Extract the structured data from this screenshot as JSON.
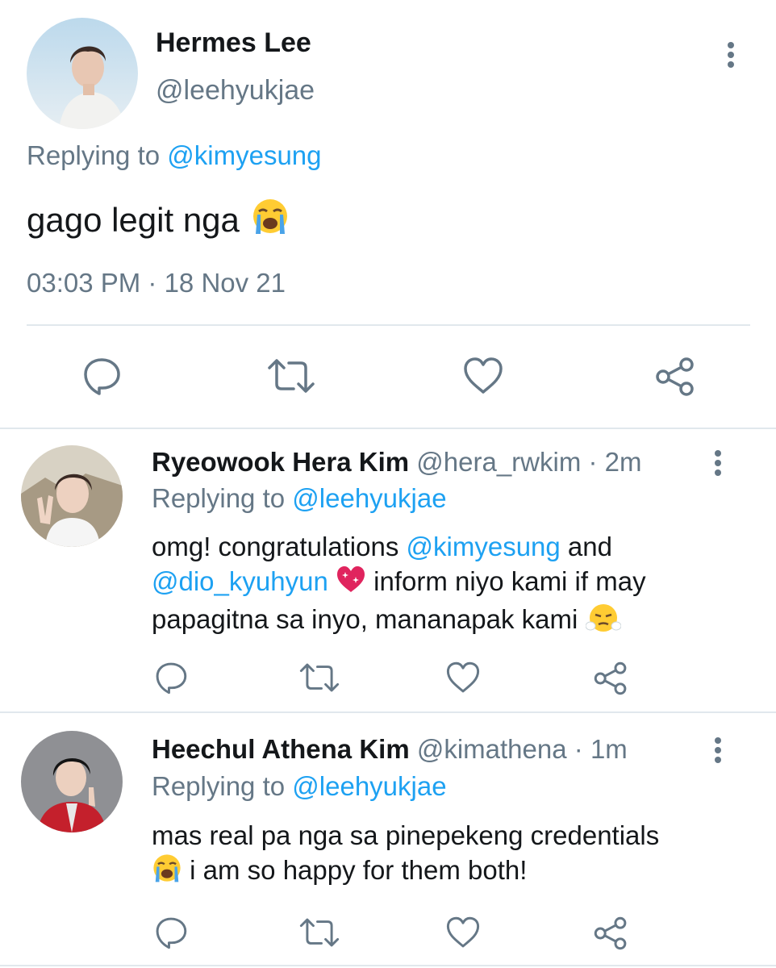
{
  "main_tweet": {
    "author_name": "Hermes Lee",
    "author_handle": "@leehyukjae",
    "replying_prefix": "Replying to",
    "replying_to": "@kimyesung",
    "text": "gago legit nga",
    "text_emoji": "loudly-crying-face-emoji",
    "timestamp": "03:03 PM · 18 Nov 21",
    "actions": [
      "reply-icon",
      "retweet-icon",
      "like-icon",
      "share-icon"
    ]
  },
  "replies": [
    {
      "author_name": "Ryeowook Hera Kim",
      "author_handle": "@hera_rwkim",
      "separator": "·",
      "time_ago": "2m",
      "replying_prefix": "Replying to",
      "replying_to": "@leehyukjae",
      "text_part1": "omg! congratulations ",
      "mention1": "@kimyesung",
      "text_part2": " and",
      "mention2": "@dio_kyuhyun",
      "text_part3": " inform niyo kami if may",
      "text_part4": "papagitna sa inyo, mananapak kami",
      "emojis": [
        "sparkling-heart-emoji",
        "face-with-steam-emoji"
      ]
    },
    {
      "author_name": "Heechul Athena Kim",
      "author_handle": "@kimathena",
      "separator": "·",
      "time_ago": "1m",
      "replying_prefix": "Replying to",
      "replying_to": "@leehyukjae",
      "text_line1": "mas real pa nga sa pinepekeng credentials",
      "text_line2": " i am so happy for them both!",
      "emojis": [
        "loudly-crying-face-emoji"
      ]
    }
  ],
  "colors": {
    "link": "#1da1f2",
    "secondary_text": "#657786",
    "divider": "#e1e8ed"
  }
}
